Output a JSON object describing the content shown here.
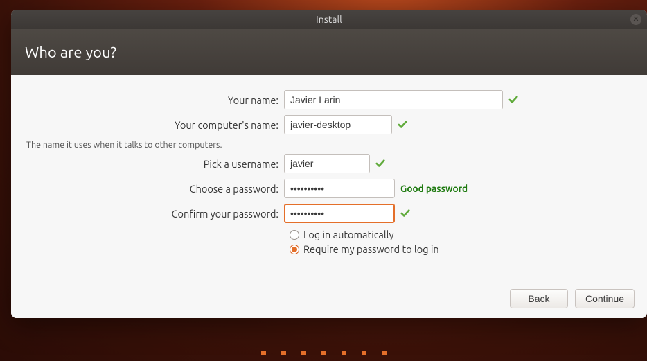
{
  "window": {
    "title": "Install"
  },
  "page": {
    "heading": "Who are you?"
  },
  "labels": {
    "name": "Your name:",
    "hostname": "Your computer's name:",
    "hostname_hint": "The name it uses when it talks to other computers.",
    "username": "Pick a username:",
    "password": "Choose a password:",
    "confirm": "Confirm your password:"
  },
  "values": {
    "name": "Javier Larin",
    "hostname": "javier-desktop",
    "username": "javier",
    "password": "••••••••••",
    "confirm": "••••••••••"
  },
  "password_strength": "Good password",
  "login_options": {
    "auto": "Log in automatically",
    "require": "Require my password to log in",
    "selected": "require"
  },
  "buttons": {
    "back": "Back",
    "continue": "Continue"
  },
  "progress": {
    "step": 6,
    "total": 7
  },
  "colors": {
    "accent": "#e46f2a",
    "valid_green": "#4caf50",
    "strength_green": "#1e7a10"
  }
}
